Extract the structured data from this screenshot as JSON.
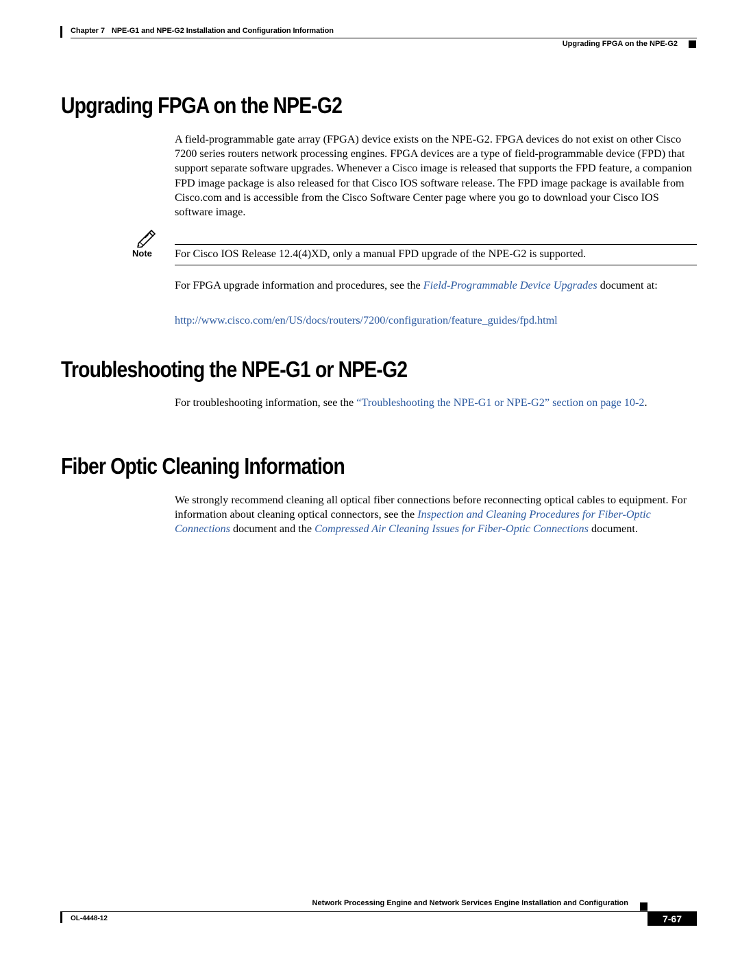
{
  "header": {
    "chapter_label": "Chapter 7",
    "chapter_title": "NPE-G1 and NPE-G2 Installation and Configuration Information",
    "section_title": "Upgrading FPGA on the NPE-G2"
  },
  "sections": [
    {
      "heading": "Upgrading FPGA on the NPE-G2",
      "paragraph": "A field-programmable gate array (FPGA) device exists on the NPE-G2. FPGA devices do not exist on other Cisco 7200 series routers network processing engines. FPGA devices are a type of field-programmable device (FPD) that support separate software upgrades. Whenever a Cisco image is released that supports the FPD feature, a companion FPD image package is also released for that Cisco IOS software release. The FPD image package is available from Cisco.com and is accessible from the Cisco Software Center page where you go to download your Cisco IOS software image.",
      "note": {
        "label": "Note",
        "text": "For Cisco IOS Release 12.4(4)XD, only a manual FPD upgrade of the NPE-G2 is supported."
      },
      "followup": {
        "prefix": "For FPGA upgrade information and procedures, see the ",
        "link": "Field-Programmable Device Upgrades",
        "suffix": " document at:"
      },
      "url": "http://www.cisco.com/en/US/docs/routers/7200/configuration/feature_guides/fpd.html"
    },
    {
      "heading": "Troubleshooting the NPE-G1 or NPE-G2",
      "prefix": "For troubleshooting information, see the ",
      "link": "“Troubleshooting the NPE-G1 or NPE-G2” section on page 10-2",
      "suffix": "."
    },
    {
      "heading": "Fiber Optic Cleaning Information",
      "prefix": "We strongly recommend cleaning all optical fiber connections before reconnecting optical cables to equipment. For information about cleaning optical connectors, see the ",
      "link1": "Inspection and Cleaning Procedures for Fiber-Optic Connections",
      "middle": " document and the ",
      "link2": "Compressed Air Cleaning Issues for Fiber-Optic Connections",
      "suffix": " document."
    }
  ],
  "footer": {
    "book_title": "Network Processing Engine and Network Services Engine Installation and Configuration",
    "doc_number": "OL-4448-12",
    "page_number": "7-67"
  }
}
